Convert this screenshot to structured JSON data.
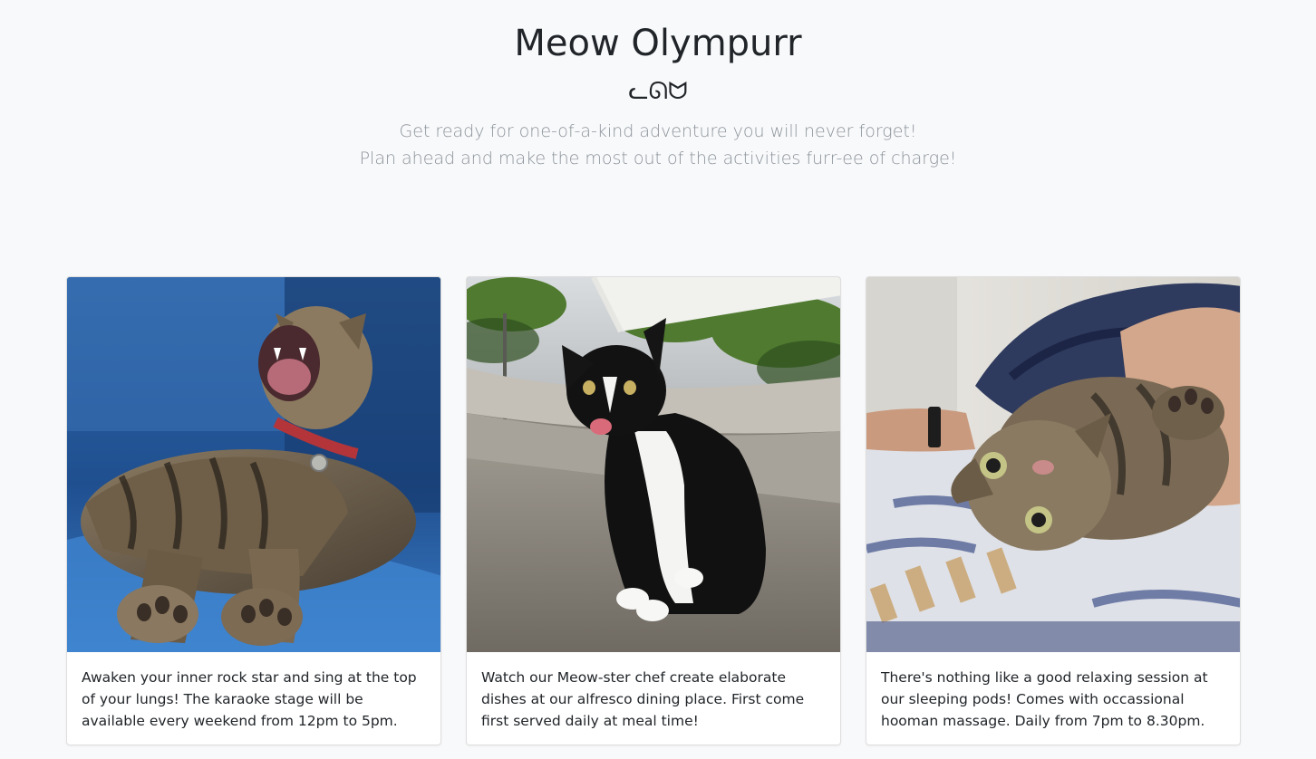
{
  "header": {
    "title": "Meow Olympurr",
    "cat_mark": "ᓚᘏᗢ",
    "tagline_line1": "Get ready for one-of-a-kind adventure you will never forget!",
    "tagline_line2": "Plan ahead and make the most out of the activities furr-ee of charge!"
  },
  "cards": [
    {
      "image": "tabby-cat-yawning-on-blue-sofa",
      "text": "Awaken your inner rock star and sing at the top of your lungs! The karaoke stage will be available every weekend from 12pm to 5pm."
    },
    {
      "image": "tuxedo-cat-sitting-outdoors",
      "text": "Watch our Meow-ster chef create elaborate dishes at our alfresco dining place. First come first served daily at meal time!"
    },
    {
      "image": "tabby-cat-lying-on-bed",
      "text": "There's nothing like a good relaxing session at our sleeping pods! Comes with occassional hooman massage. Daily from 7pm to 8.30pm."
    }
  ]
}
